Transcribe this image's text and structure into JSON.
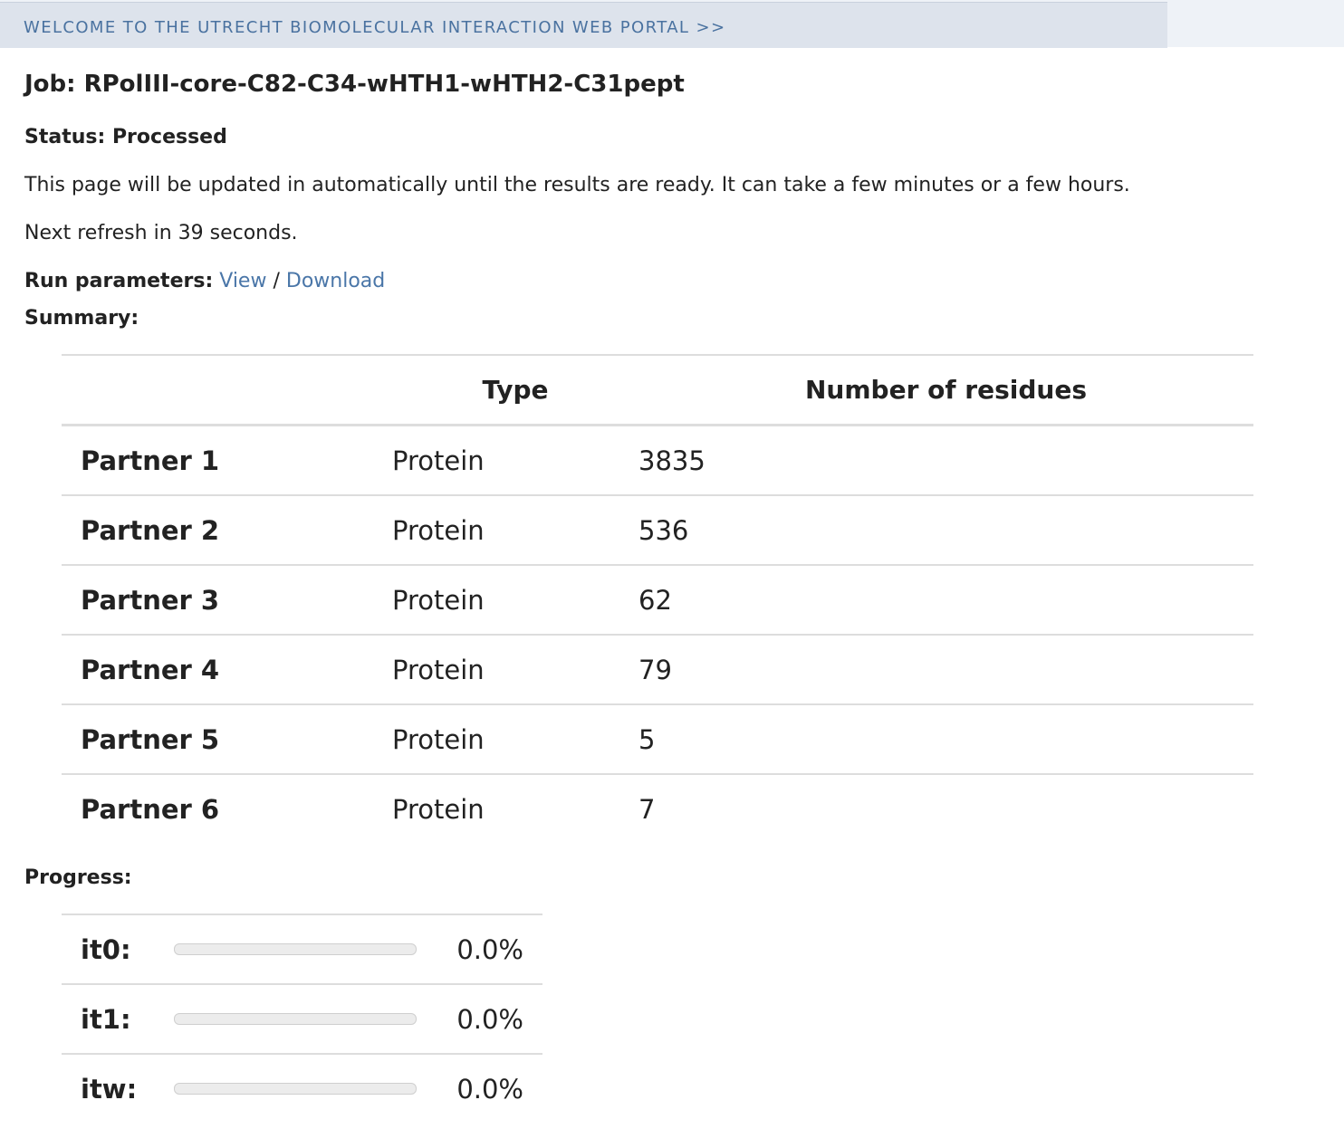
{
  "header": {
    "welcome_link": "WELCOME TO THE UTRECHT BIOMOLECULAR INTERACTION WEB PORTAL >>"
  },
  "job": {
    "title": "Job: RPolIII-core-C82-C34-wHTH1-wHTH2-C31pept",
    "status": "Status: Processed",
    "info": "This page will be updated in automatically until the results are ready. It can take a few minutes or a few hours.",
    "refresh": "Next refresh in 39 seconds."
  },
  "run_parameters": {
    "label": "Run parameters:",
    "view": "View",
    "separator": "/",
    "download": "Download"
  },
  "summary": {
    "label": "Summary:",
    "headers": [
      "",
      "Type",
      "Number of residues"
    ],
    "rows": [
      {
        "name": "Partner 1",
        "type": "Protein",
        "residues": "3835"
      },
      {
        "name": "Partner 2",
        "type": "Protein",
        "residues": "536"
      },
      {
        "name": "Partner 3",
        "type": "Protein",
        "residues": "62"
      },
      {
        "name": "Partner 4",
        "type": "Protein",
        "residues": "79"
      },
      {
        "name": "Partner 5",
        "type": "Protein",
        "residues": "5"
      },
      {
        "name": "Partner 6",
        "type": "Protein",
        "residues": "7"
      }
    ]
  },
  "progress": {
    "label": "Progress:",
    "items": [
      {
        "name": "it0:",
        "percent_text": "0.0%",
        "percent": 0.0
      },
      {
        "name": "it1:",
        "percent_text": "0.0%",
        "percent": 0.0
      },
      {
        "name": "itw:",
        "percent_text": "0.0%",
        "percent": 0.0
      }
    ]
  },
  "colors": {
    "link": "#4a76a8",
    "header_band": "#dde3ec",
    "header_text": "#4a72a0"
  }
}
